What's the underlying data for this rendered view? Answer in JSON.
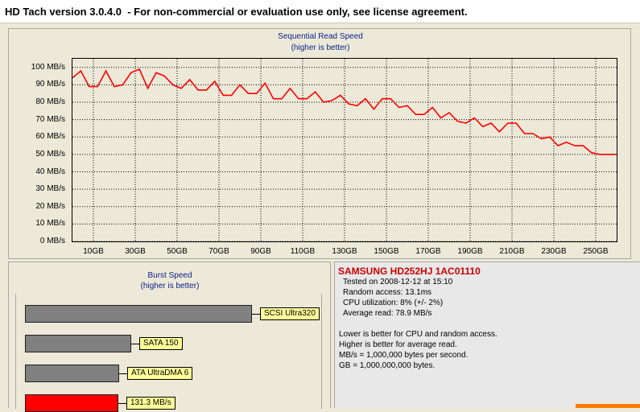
{
  "window": {
    "title": "HD Tach version 3.0.4.0  - For non-commercial or evaluation use only, see license agreement."
  },
  "chart_data": [
    {
      "type": "line",
      "title": "Sequential Read Speed",
      "subtitle": "(higher is better)",
      "xlabel": "",
      "ylabel": "",
      "xlim": [
        0,
        260
      ],
      "ylim": [
        0,
        105
      ],
      "grid": true,
      "x_ticks": [
        "10GB",
        "30GB",
        "50GB",
        "70GB",
        "90GB",
        "110GB",
        "130GB",
        "150GB",
        "170GB",
        "190GB",
        "210GB",
        "230GB",
        "250GB"
      ],
      "y_ticks": [
        "0 MB/s",
        "10 MB/s",
        "20 MB/s",
        "30 MB/s",
        "40 MB/s",
        "50 MB/s",
        "60 MB/s",
        "70 MB/s",
        "80 MB/s",
        "90 MB/s",
        "100 MB/s"
      ],
      "series": [
        {
          "color": "#FF0000",
          "x": [
            0,
            4,
            8,
            12,
            16,
            20,
            24,
            28,
            32,
            36,
            40,
            44,
            48,
            52,
            56,
            60,
            64,
            68,
            72,
            76,
            80,
            84,
            88,
            92,
            96,
            100,
            104,
            108,
            112,
            116,
            120,
            124,
            128,
            132,
            136,
            140,
            144,
            148,
            152,
            156,
            160,
            164,
            168,
            172,
            176,
            180,
            184,
            188,
            192,
            196,
            200,
            204,
            208,
            212,
            216,
            220,
            224,
            228,
            232,
            236,
            240,
            244,
            248,
            252,
            256,
            260
          ],
          "y": [
            94,
            98,
            89,
            89,
            98,
            89,
            90,
            97,
            99,
            88,
            97,
            95,
            90,
            88,
            93,
            87,
            87,
            92,
            84,
            84,
            90,
            85,
            85,
            91,
            82,
            82,
            88,
            82,
            82,
            86,
            80,
            81,
            84,
            79,
            78,
            82,
            76,
            82,
            82,
            77,
            78,
            73,
            73,
            77,
            71,
            74,
            69,
            68,
            71,
            66,
            68,
            63,
            68,
            68,
            62,
            62,
            59,
            60,
            55,
            57,
            55,
            55,
            51,
            50,
            50,
            50
          ]
        }
      ]
    },
    {
      "type": "bar",
      "title": "Burst Speed",
      "subtitle": "(higher is better)",
      "orientation": "horizontal",
      "categories": [
        "SCSI Ultra320",
        "SATA 150",
        "ATA UltraDMA 6",
        "131.3 MB/s"
      ],
      "values": [
        320,
        150,
        133,
        131.3
      ],
      "colors": [
        "#808080",
        "#808080",
        "#808080",
        "#FF0000"
      ],
      "xlim": [
        0,
        432
      ]
    }
  ],
  "info": {
    "drive_name": "SAMSUNG HD252HJ 1AC01110",
    "tested_on": "Tested on 2008-12-12 at 15:10",
    "random_access": "Random access: 13.1ms",
    "cpu_utilization": "CPU utilization: 8% (+/- 2%)",
    "average_read": "Average read: 78.9 MB/s",
    "note_1": "Lower is better for CPU and random access.",
    "note_2": "Higher is better for average read.",
    "note_3": "MB/s = 1,000,000 bytes per second.",
    "note_4": "GB = 1,000,000,000 bytes."
  }
}
